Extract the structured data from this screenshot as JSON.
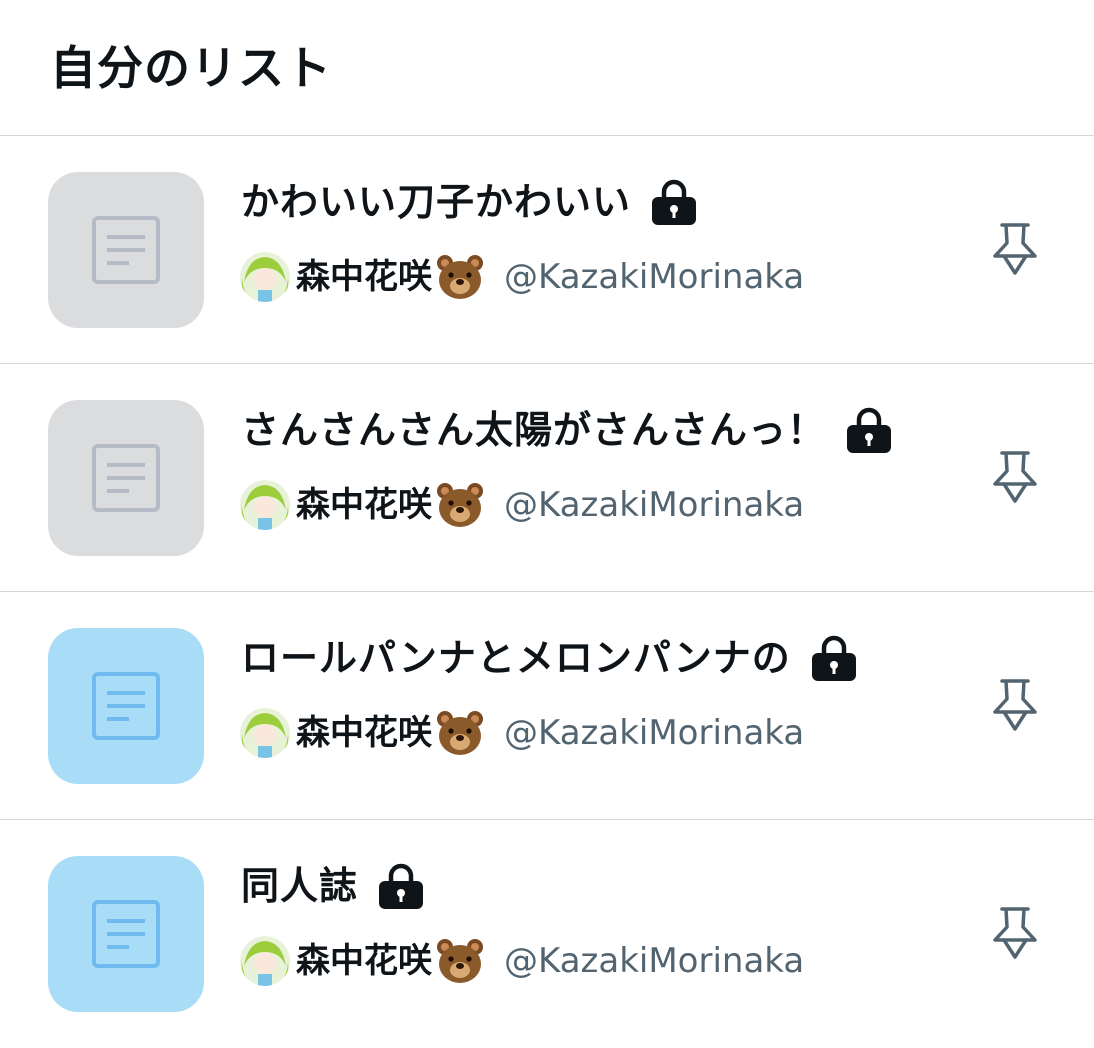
{
  "header": {
    "title": "自分のリスト"
  },
  "lists": [
    {
      "name": "かわいい刀子かわいい",
      "owner_name": "森中花咲",
      "owner_handle": "@KazakiMorinaka",
      "thumb_bg": "#dbdcde",
      "thumb_icon_color": "#b5bac7",
      "private": true,
      "icons": [
        "list-icon",
        "lock-icon",
        "bear-icon",
        "pin-icon"
      ]
    },
    {
      "name": "さんさんさん太陽がさんさんっ！",
      "owner_name": "森中花咲",
      "owner_handle": "@KazakiMorinaka",
      "thumb_bg": "#dbdcde",
      "thumb_icon_color": "#b5bac7",
      "private": true,
      "icons": [
        "list-icon",
        "lock-icon",
        "bear-icon",
        "pin-icon"
      ]
    },
    {
      "name": "ロールパンナとメロンパンナの",
      "owner_name": "森中花咲",
      "owner_handle": "@KazakiMorinaka",
      "thumb_bg": "#a8dcf7",
      "thumb_icon_color": "#6fbbf0",
      "private": true,
      "icons": [
        "list-icon",
        "lock-icon",
        "bear-icon",
        "pin-icon"
      ]
    },
    {
      "name": "同人誌",
      "owner_name": "森中花咲",
      "owner_handle": "@KazakiMorinaka",
      "thumb_bg": "#a8dcf7",
      "thumb_icon_color": "#6fbbf0",
      "private": true,
      "icons": [
        "list-icon",
        "lock-icon",
        "bear-icon",
        "pin-icon"
      ]
    }
  ],
  "colors": {
    "text_primary": "#0f1419",
    "text_secondary": "#536471",
    "divider": "#cfd9de",
    "pin_icon": "#536471"
  }
}
